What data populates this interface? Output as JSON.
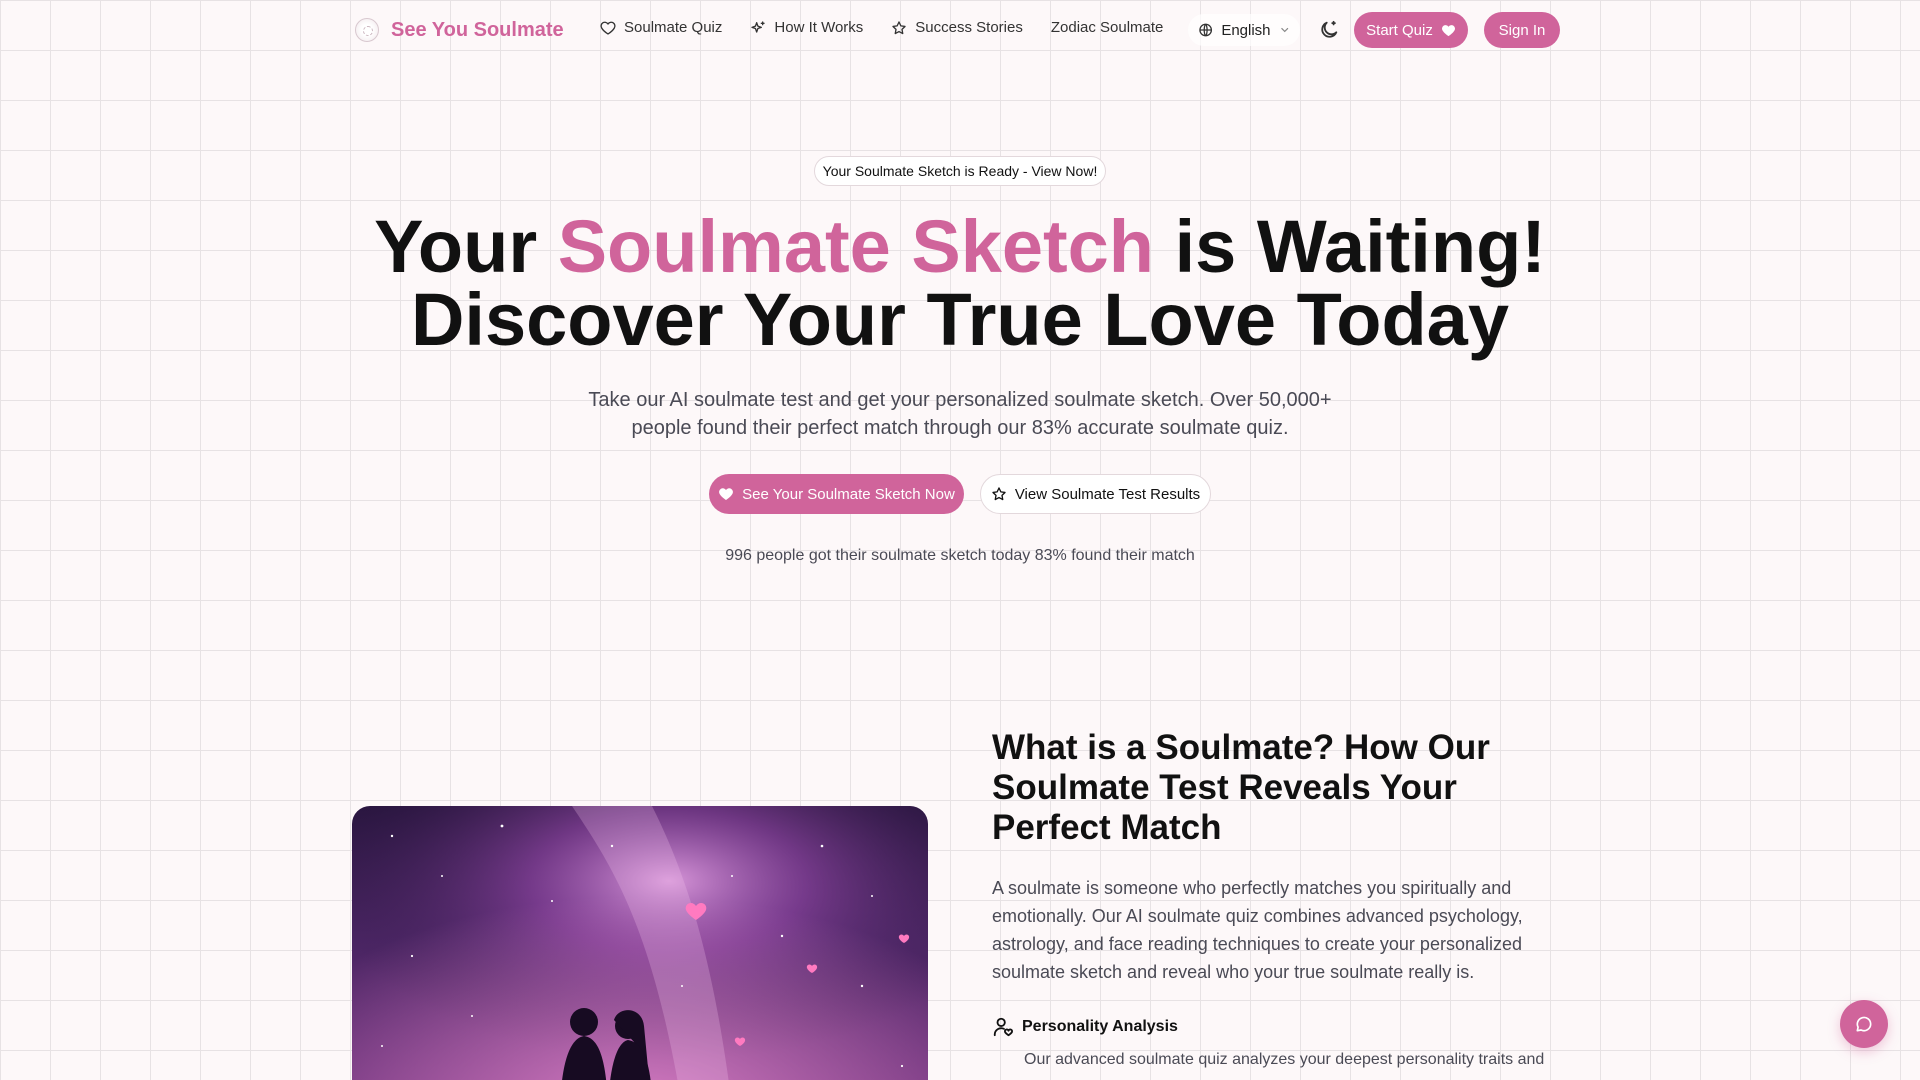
{
  "nav": {
    "logo_text": "See You Soulmate",
    "links": [
      {
        "label": "Soulmate Quiz",
        "icon": "heart-icon"
      },
      {
        "label": "How It Works",
        "icon": "sparkles-icon"
      },
      {
        "label": "Success Stories",
        "icon": "star-icon"
      },
      {
        "label": "Zodiac Soulmate",
        "icon": ""
      }
    ],
    "language": "English",
    "start_quiz": "Start Quiz",
    "sign_in": "Sign In"
  },
  "hero": {
    "badge": "Your Soulmate Sketch is Ready - View Now!",
    "title_before": "Your ",
    "title_accent": "Soulmate Sketch",
    "title_after": " is Waiting!",
    "title_line2": "Discover Your True Love Today",
    "subtitle": "Take our AI soulmate test and get your personalized soulmate sketch. Over 50,000+ people found their perfect match through our 83% accurate soulmate quiz.",
    "cta_primary": "See Your Soulmate Sketch Now",
    "cta_secondary": "View Soulmate Test Results",
    "stats": "996 people got their soulmate sketch today 83% found their match"
  },
  "section2": {
    "title": "What is a Soulmate? How Our Soulmate Test Reveals Your Perfect Match",
    "body": "A soulmate is someone who perfectly matches you spiritually and emotionally. Our AI soulmate quiz combines advanced psychology, astrology, and face reading techniques to create your personalized soulmate sketch and reveal who your true soulmate really is.",
    "feature_title": "Personality Analysis",
    "feature_body": "Our advanced soulmate quiz analyzes your deepest personality traits and"
  },
  "colors": {
    "accent": "#d0649b",
    "background": "#fdf8f9",
    "text": "#111111",
    "muted": "#4a4a55"
  }
}
